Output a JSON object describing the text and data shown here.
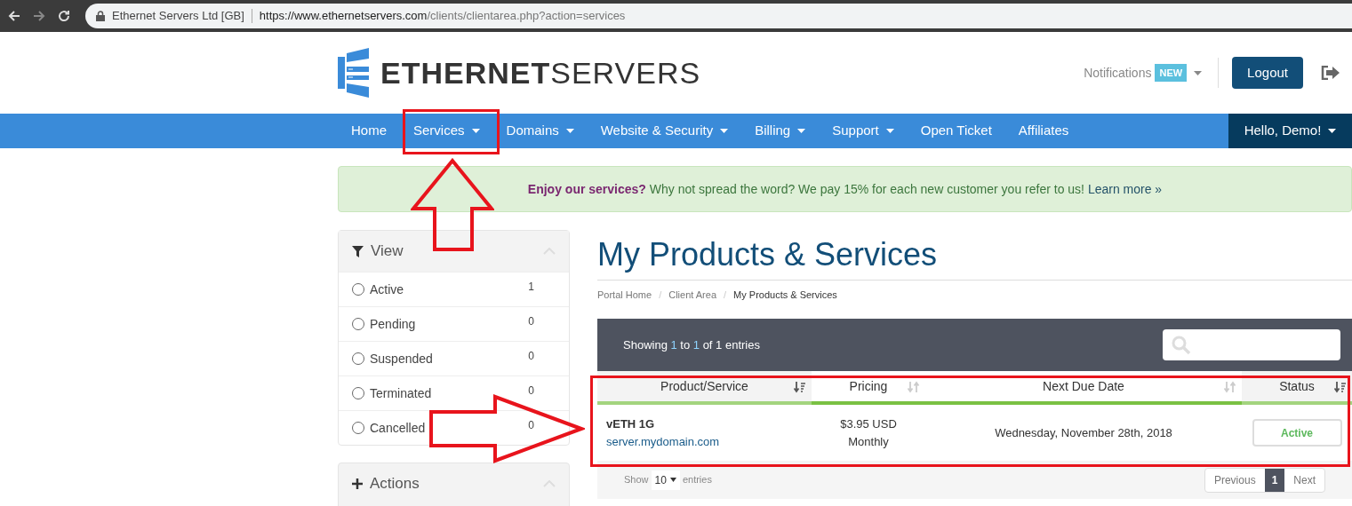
{
  "browser": {
    "site_name": "Ethernet Servers Ltd [GB]",
    "url_host": "https://www.ethernetservers.com",
    "url_path": "/clients/clientarea.php?action=services"
  },
  "logo": {
    "bold": "ETHERNET",
    "light": "SERVERS"
  },
  "header": {
    "notifications": "Notifications",
    "badge": "NEW",
    "logout": "Logout"
  },
  "nav": {
    "items": [
      {
        "label": "Home",
        "dropdown": false
      },
      {
        "label": "Services",
        "dropdown": true
      },
      {
        "label": "Domains",
        "dropdown": true
      },
      {
        "label": "Website & Security",
        "dropdown": true
      },
      {
        "label": "Billing",
        "dropdown": true
      },
      {
        "label": "Support",
        "dropdown": true
      },
      {
        "label": "Open Ticket",
        "dropdown": false
      },
      {
        "label": "Affiliates",
        "dropdown": false
      }
    ],
    "user": "Hello, Demo!"
  },
  "banner": {
    "lead": "Enjoy our services?",
    "text": "Why not spread the word? We pay 15% for each new customer you refer to us!",
    "link": "Learn more »"
  },
  "sidebar": {
    "view_title": "View",
    "filters": [
      {
        "label": "Active",
        "count": "1",
        "selected": false
      },
      {
        "label": "Pending",
        "count": "0",
        "selected": false
      },
      {
        "label": "Suspended",
        "count": "0",
        "selected": false
      },
      {
        "label": "Terminated",
        "count": "0",
        "selected": false
      },
      {
        "label": "Cancelled",
        "count": "0",
        "selected": false
      }
    ],
    "actions_title": "Actions"
  },
  "page": {
    "title": "My Products & Services",
    "breadcrumb": [
      "Portal Home",
      "Client Area",
      "My Products & Services"
    ],
    "separator": "/"
  },
  "table": {
    "info_prefix": "Showing ",
    "from": "1",
    "to_word": " to ",
    "to": "1",
    "of_word": " of ",
    "total": "1",
    "info_suffix": " entries",
    "columns": [
      {
        "label": "Product/Service",
        "sorted": true
      },
      {
        "label": "Pricing",
        "sorted": false
      },
      {
        "label": "Next Due Date",
        "sorted": false
      },
      {
        "label": "Status",
        "sorted": true
      }
    ],
    "rows": [
      {
        "product": "vETH 1G",
        "domain": "server.mydomain.com",
        "price": "$3.95 USD",
        "cycle": "Monthly",
        "due": "Wednesday, November 28th, 2018",
        "status": "Active"
      }
    ],
    "show": "Show",
    "page_size": "10",
    "entries": "entries",
    "previous": "Previous",
    "page": "1",
    "next": "Next"
  }
}
